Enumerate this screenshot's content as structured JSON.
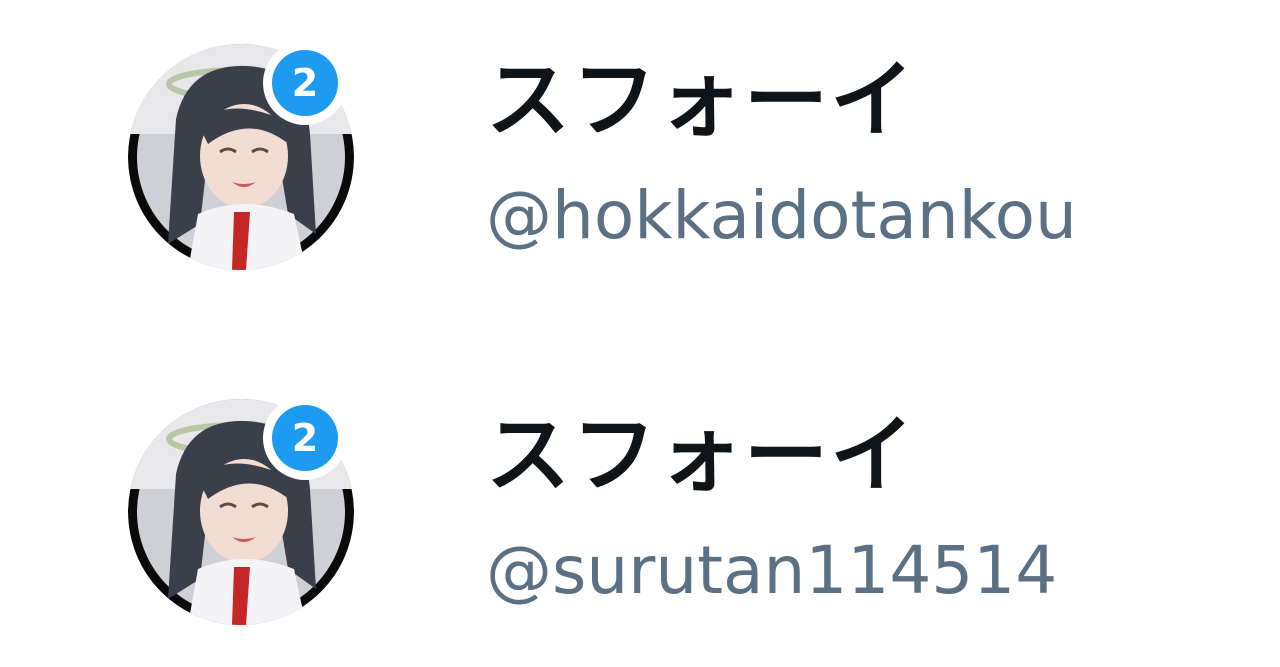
{
  "accounts": [
    {
      "display_name": "スフォーイ",
      "handle": "@hokkaidotankou",
      "badge_count": "2"
    },
    {
      "display_name": "スフォーイ",
      "handle": "@surutan114514",
      "badge_count": "2"
    }
  ],
  "colors": {
    "badge": "#1d9bf0",
    "name": "#0f1419",
    "handle": "#5b7083"
  },
  "icons": {
    "avatar": "anime-girl-avatar",
    "badge": "notification-badge"
  }
}
